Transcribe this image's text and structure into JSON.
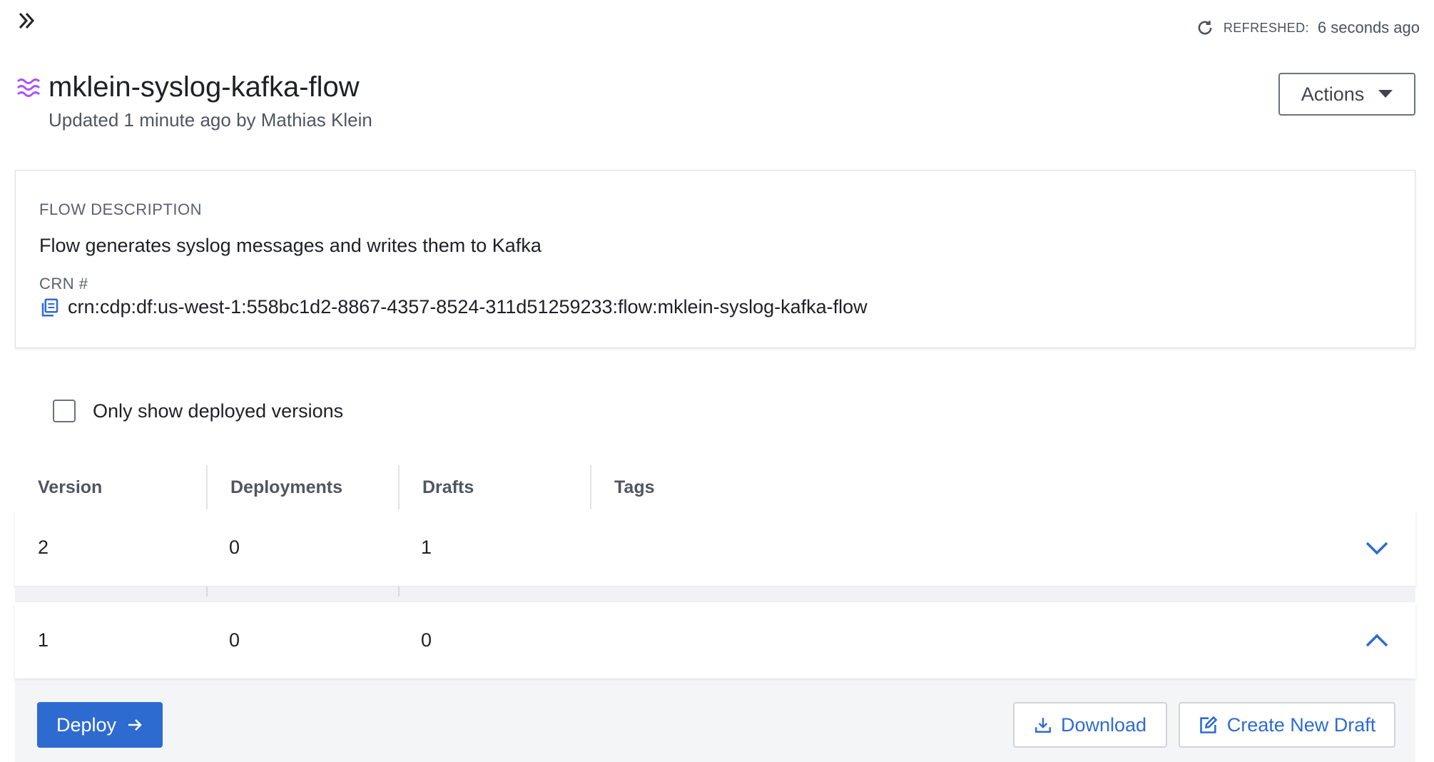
{
  "topbar": {
    "expand_icon": "double-chevron-right-icon",
    "refresh_icon": "refresh-icon",
    "refreshed_label": "REFRESHED:",
    "refreshed_value": "6 seconds ago"
  },
  "header": {
    "flow_icon": "flow-waves-icon",
    "title": "mklein-syslog-kafka-flow",
    "subtitle": "Updated 1 minute ago by Mathias Klein",
    "actions_label": "Actions"
  },
  "description_card": {
    "desc_label": "FLOW DESCRIPTION",
    "desc_text": "Flow generates syslog messages and writes them to Kafka",
    "crn_label": "CRN #",
    "crn_value": "crn:cdp:df:us-west-1:558bc1d2-8867-4357-8524-311d51259233:flow:mklein-syslog-kafka-flow",
    "copy_icon": "copy-icon"
  },
  "filter": {
    "only_deployed_label": "Only show deployed versions",
    "checked": false
  },
  "table": {
    "columns": [
      "Version",
      "Deployments",
      "Drafts",
      "Tags"
    ],
    "rows": [
      {
        "version": "2",
        "deployments": "0",
        "drafts": "1",
        "tags": "",
        "expanded": false
      },
      {
        "version": "1",
        "deployments": "0",
        "drafts": "0",
        "tags": "",
        "expanded": true
      }
    ]
  },
  "expanded_actions": {
    "deploy_label": "Deploy",
    "download_label": "Download",
    "create_draft_label": "Create New Draft"
  },
  "colors": {
    "accent": "#2e6bd1",
    "flow_icon": "#a855f7"
  }
}
